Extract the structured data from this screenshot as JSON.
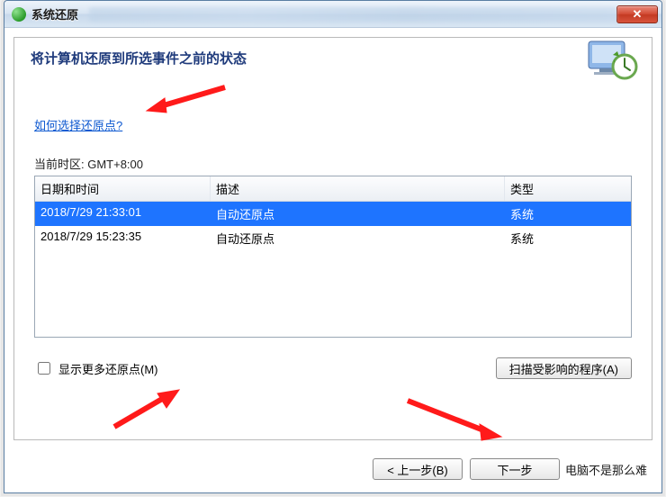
{
  "window": {
    "title": "系统还原",
    "close_glyph": "✕"
  },
  "header": {
    "heading": "将计算机还原到所选事件之前的状态"
  },
  "help_link": "如何选择还原点?",
  "timezone_label": "当前时区: GMT+8:00",
  "table": {
    "columns": {
      "datetime": "日期和时间",
      "description": "描述",
      "type": "类型"
    },
    "rows": [
      {
        "datetime": "2018/7/29 21:33:01",
        "description": "自动还原点",
        "type": "系统",
        "selected": true
      },
      {
        "datetime": "2018/7/29 15:23:35",
        "description": "自动还原点",
        "type": "系统",
        "selected": false
      }
    ]
  },
  "show_more": {
    "label": "显示更多还原点(M)",
    "checked": false
  },
  "scan_button": "扫描受影响的程序(A)",
  "wizard": {
    "back": "< 上一步(B)",
    "next": "下一步",
    "tail_text": "电脑不是那么难"
  },
  "colors": {
    "accent_arrow": "#ff1a1a",
    "selection": "#1e74ff",
    "link": "#0b57d0"
  }
}
